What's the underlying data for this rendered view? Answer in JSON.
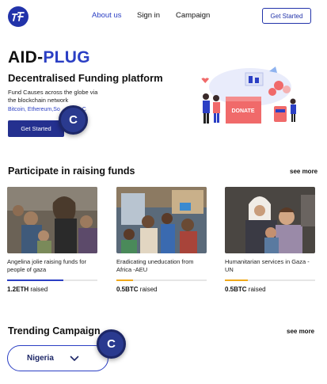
{
  "header": {
    "logo_icon": "aid-plug-logo-icon",
    "nav": {
      "about": "About us",
      "signin": "Sign in",
      "campaign": "Campaign"
    },
    "get_started": "Get Started"
  },
  "hero": {
    "brand_part1": "AID-",
    "brand_part2": "PLUG",
    "tagline": "Decentralised Funding platform",
    "description": "Fund Causes across the globe via the blockchain network",
    "chains": "Bitcoin, Ethereum,So",
    "chains_suffix": "C",
    "button": "Get Started",
    "illustration_label": "DONATE"
  },
  "cursor": {
    "letter": "C"
  },
  "raising": {
    "title": "Participate in raising funds",
    "see_more": "see more",
    "raised_word": "raised",
    "cards": [
      {
        "caption": "Angelina jolie raising funds for people of gaza",
        "amount": "1.2ETH",
        "progress": 0.62,
        "color": "#2b3fc4"
      },
      {
        "caption": "Eradicating uneducation from Africa -AEU",
        "amount": "0.5BTC",
        "progress": 0.18,
        "color": "#f0a91b"
      },
      {
        "caption": "Humanitarian services in Gaza -UN",
        "amount": "0.5BTC",
        "progress": 0.25,
        "color": "#f0a91b"
      }
    ]
  },
  "trending": {
    "title": "Trending Campaign",
    "see_more": "see more",
    "dropdown_value": "Nigeria"
  },
  "colors": {
    "primary": "#2233aa",
    "link": "#2b3fc4",
    "accent": "#f0a91b"
  }
}
